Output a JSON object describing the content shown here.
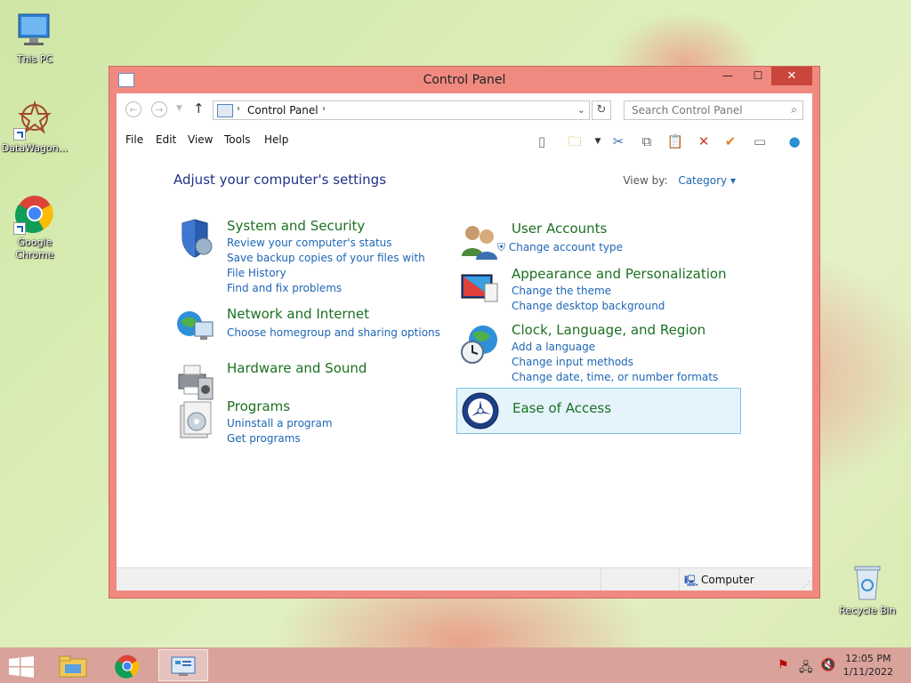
{
  "desktop": {
    "icons": [
      {
        "label": "This PC",
        "icon": "this-pc-icon"
      },
      {
        "label": "DataWagon...",
        "icon": "datawagon-icon"
      },
      {
        "label": "Google Chrome",
        "icon": "chrome-icon"
      },
      {
        "label": "Recycle Bin",
        "icon": "recycle-bin-icon"
      }
    ]
  },
  "window": {
    "title": "Control Panel",
    "controls": {
      "minimize": "—",
      "maximize": "☐",
      "close": "✕"
    },
    "accent_color": "#f08a80",
    "address": {
      "crumb": "Control Panel"
    },
    "search": {
      "placeholder": "Search Control Panel"
    },
    "menu": [
      "File",
      "Edit",
      "View",
      "Tools",
      "Help"
    ],
    "heading": "Adjust your computer's settings",
    "view_by": {
      "label": "View by:",
      "value": "Category"
    },
    "categories": [
      {
        "title": "System and Security",
        "icon": "shield-icon",
        "links": [
          "Review your computer's status",
          "Save backup copies of your files with File History",
          "Find and fix problems"
        ]
      },
      {
        "title": "Network and Internet",
        "icon": "network-icon",
        "links": [
          "Choose homegroup and sharing options"
        ]
      },
      {
        "title": "Hardware and Sound",
        "icon": "printer-icon",
        "links": []
      },
      {
        "title": "Programs",
        "icon": "programs-icon",
        "links": [
          "Uninstall a program",
          "Get programs"
        ]
      },
      {
        "title": "User Accounts",
        "icon": "users-icon",
        "links": [
          "Change account type"
        ]
      },
      {
        "title": "Appearance and Personalization",
        "icon": "appearance-icon",
        "links": [
          "Change the theme",
          "Change desktop background"
        ]
      },
      {
        "title": "Clock, Language, and Region",
        "icon": "globe-clock-icon",
        "links": [
          "Add a language",
          "Change input methods",
          "Change date, time, or number formats"
        ]
      },
      {
        "title": "Ease of Access",
        "icon": "ease-of-access-icon",
        "links": []
      }
    ],
    "status": {
      "location": "Computer"
    }
  },
  "taskbar": {
    "time": "12:05 PM",
    "date": "1/11/2022"
  }
}
